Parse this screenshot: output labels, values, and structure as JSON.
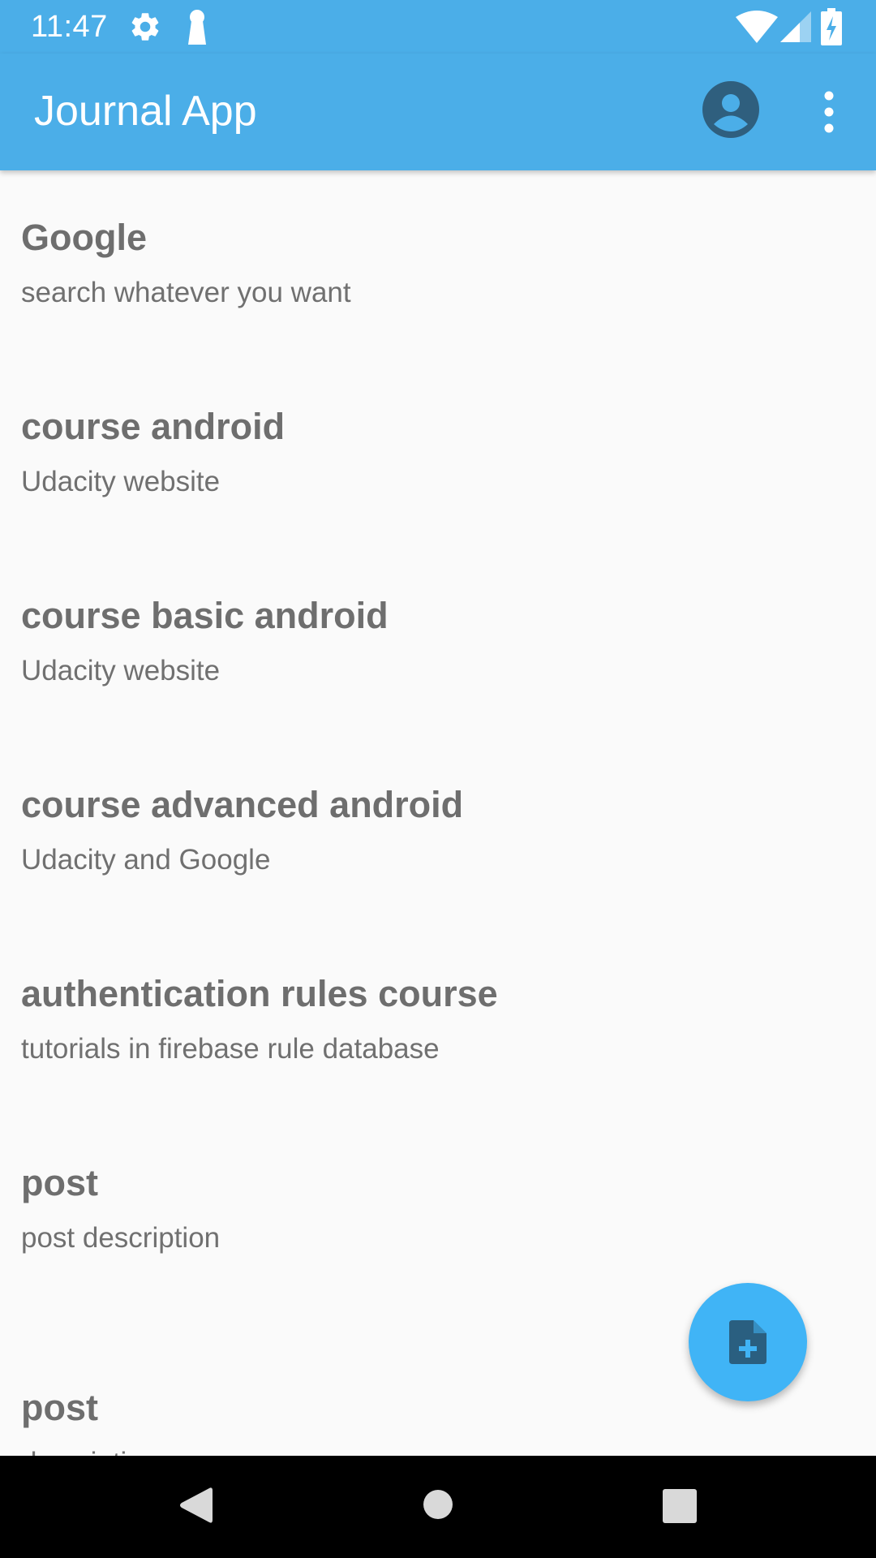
{
  "status_bar": {
    "time": "11:47",
    "left_icons": [
      "gear-icon",
      "keyhole-icon"
    ],
    "right_icons": [
      "wifi-icon",
      "signal-icon",
      "battery-charging-icon"
    ]
  },
  "app_bar": {
    "title": "Journal App",
    "actions": [
      "account-circle-icon",
      "more-vert-icon"
    ]
  },
  "entries": [
    {
      "title": "Google",
      "description": "search whatever you want"
    },
    {
      "title": "course android",
      "description": "Udacity website"
    },
    {
      "title": "course basic android",
      "description": "Udacity website"
    },
    {
      "title": "course advanced android",
      "description": "Udacity and Google"
    },
    {
      "title": "authentication rules course",
      "description": "tutorials in firebase rule database"
    },
    {
      "title": "post",
      "description": "post description"
    },
    {
      "title": "post",
      "description": "description"
    }
  ],
  "fab": {
    "icon": "note-add-icon"
  },
  "nav_bar": {
    "buttons": [
      "back-icon",
      "home-icon",
      "recents-icon"
    ]
  },
  "colors": {
    "primary": "#4baee8",
    "accent": "#40b4f6",
    "title_text": "#6e6e6e",
    "body_text": "#707070",
    "background": "#fafafa"
  }
}
